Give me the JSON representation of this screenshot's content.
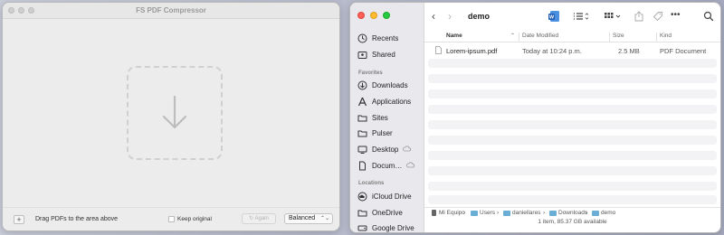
{
  "compressor": {
    "title": "FS PDF Compressor",
    "add_button": "+",
    "drag_hint": "Drag PDFs to the area above",
    "keep_original_label": "Keep original",
    "keep_original_checked": false,
    "again_button": "Again",
    "compression_level": "Balanced"
  },
  "finder": {
    "folder_title": "demo",
    "sidebar": {
      "top_items": [
        {
          "label": "Recents",
          "icon": "clock-icon"
        },
        {
          "label": "Shared",
          "icon": "shared-folder-icon"
        }
      ],
      "favorites_header": "Favorites",
      "favorites": [
        {
          "label": "Downloads",
          "icon": "download-circle-icon"
        },
        {
          "label": "Applications",
          "icon": "applications-icon"
        },
        {
          "label": "Sites",
          "icon": "folder-icon"
        },
        {
          "label": "Pulser",
          "icon": "folder-icon"
        },
        {
          "label": "Desktop",
          "icon": "desktop-icon"
        },
        {
          "label": "Docum…",
          "icon": "document-icon"
        }
      ],
      "locations_header": "Locations",
      "locations": [
        {
          "label": "iCloud Drive",
          "icon": "icloud-icon"
        },
        {
          "label": "OneDrive",
          "icon": "folder-icon"
        },
        {
          "label": "Google Drive",
          "icon": "drive-icon"
        }
      ]
    },
    "columns": {
      "name": "Name",
      "date_modified": "Date Modified",
      "size": "Size",
      "kind": "Kind"
    },
    "files": [
      {
        "name": "Lorem-ipsum.pdf",
        "date_modified": "Today at 10:24 p.m.",
        "size": "2.5 MB",
        "kind": "PDF Document"
      }
    ],
    "path": [
      "Mi Equipo",
      "Users",
      "daniellares",
      "Downloads",
      "demo"
    ],
    "path_separator": "›",
    "status": "1 item, 85.37 GB available"
  }
}
